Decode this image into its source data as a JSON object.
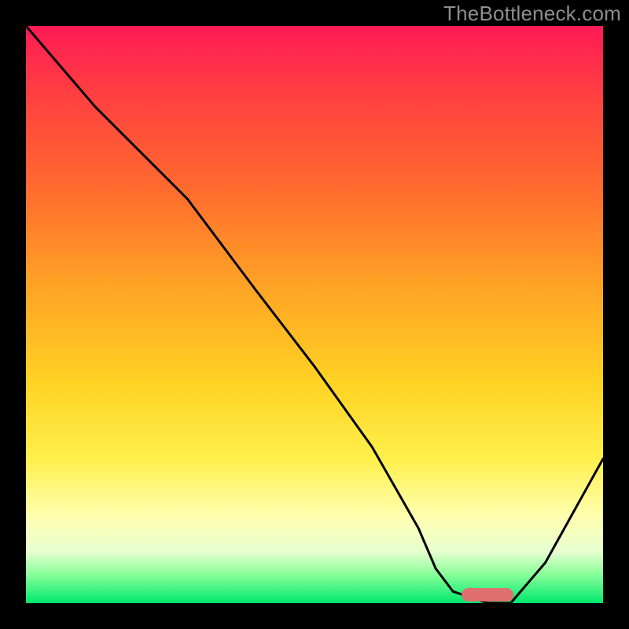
{
  "watermark": "TheBottleneck.com",
  "chart_data": {
    "type": "line",
    "title": "",
    "xlabel": "",
    "ylabel": "",
    "xlim": [
      0,
      100
    ],
    "ylim": [
      0,
      100
    ],
    "grid": false,
    "series": [
      {
        "name": "bottleneck-curve",
        "color": "#000000",
        "x": [
          0,
          6,
          12,
          18,
          24,
          28,
          40,
          50,
          60,
          68,
          71,
          74,
          80,
          84,
          90,
          100
        ],
        "y": [
          100,
          93,
          86,
          80,
          74,
          70,
          54,
          41,
          27,
          13,
          6,
          2,
          0,
          0,
          7,
          25
        ]
      }
    ],
    "optimal_marker": {
      "x": 80,
      "width": 9,
      "color": "#e06f6f"
    }
  },
  "colors": {
    "bg": "#000000",
    "gradient_top": "#ff1a55",
    "gradient_mid": "#ffd324",
    "gradient_bottom": "#00e86c",
    "marker": "#e06f6f",
    "curve": "#000000",
    "watermark": "#8e8e8e"
  }
}
